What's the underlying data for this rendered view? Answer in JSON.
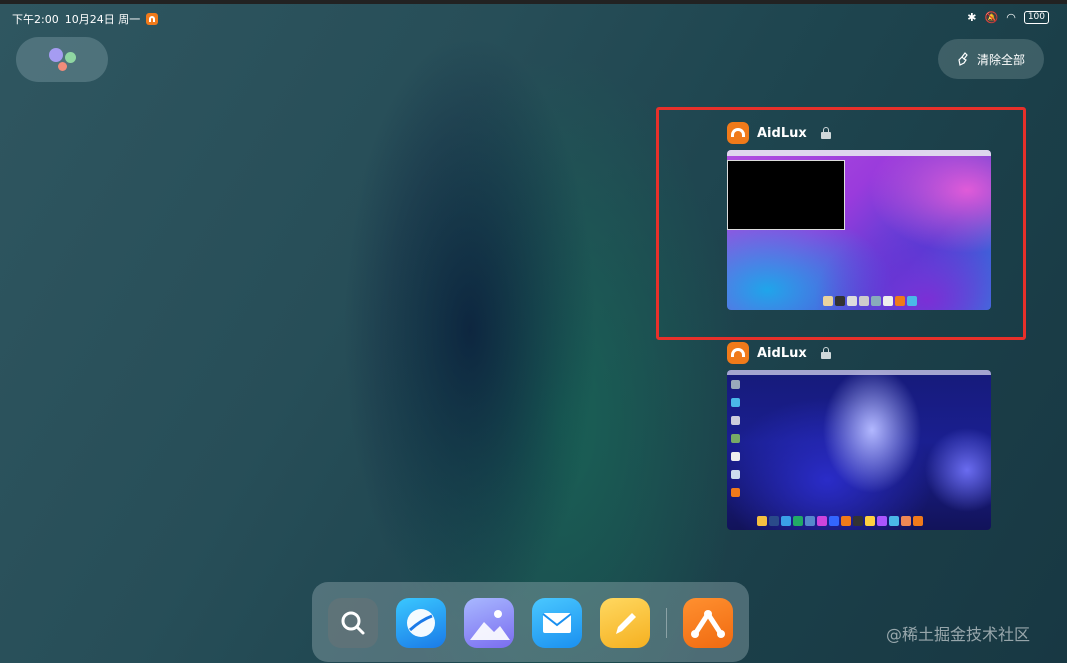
{
  "status_bar": {
    "time": "下午2:00",
    "date": "10月24日 周一",
    "battery": "100"
  },
  "clear_all": {
    "label": "清除全部"
  },
  "recent_apps": [
    {
      "name": "AidLux"
    },
    {
      "name": "AidLux"
    }
  ],
  "watermark": "@稀土掘金技术社区",
  "colors": {
    "accent_orange": "#f07a1a",
    "highlight_red": "#e8302a"
  },
  "dock_icons": [
    "search-icon",
    "browser-icon",
    "gallery-icon",
    "mail-icon",
    "notes-icon",
    "aidlux-icon"
  ]
}
